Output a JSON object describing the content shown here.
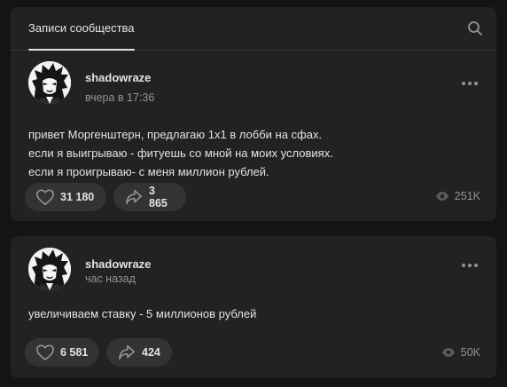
{
  "header": {
    "tab_label": "Записи сообщества",
    "search_icon": "search-icon"
  },
  "posts": [
    {
      "author": "shadowraze",
      "time": "вчера в 17:36",
      "text_lines": [
        "привет Моргенштерн, предлагаю 1х1 в лобби на сфах.",
        "если я выигрываю - фитуешь со мной на моих условиях.",
        "если я проигрываю- с меня миллион рублей."
      ],
      "likes": "31 180",
      "shares": "3 865",
      "views": "251K"
    },
    {
      "author": "shadowraze",
      "time": "час назад",
      "text_lines": [
        "увеличиваем ставку - 5 миллионов рублей"
      ],
      "likes": "6 581",
      "shares": "424",
      "views": "50K"
    }
  ],
  "colors": {
    "page_bg": "#141414",
    "card_bg": "#222222",
    "button_bg": "#333333",
    "text_primary": "#e1e3e6",
    "text_secondary": "#939393"
  }
}
